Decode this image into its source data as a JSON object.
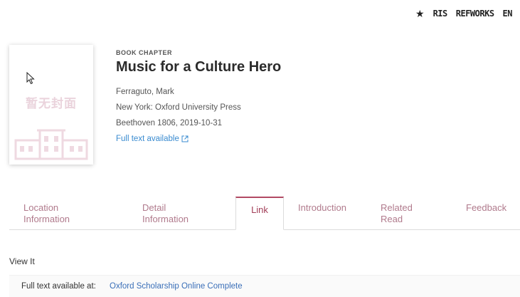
{
  "top_actions": {
    "items": [
      {
        "label": "RIS"
      },
      {
        "label": "REFWORKS"
      },
      {
        "label": "EN"
      }
    ]
  },
  "cover": {
    "placeholder_text": "暂无封面"
  },
  "record": {
    "type": "BOOK CHAPTER",
    "title": "Music for a Culture Hero",
    "author": "Ferraguto, Mark",
    "publisher": "New York: Oxford University Press",
    "source": "Beethoven 1806, 2019-10-31",
    "fulltext_label": "Full text available"
  },
  "tabs": [
    {
      "line1": "Location",
      "line2": "Information",
      "active": false
    },
    {
      "line1": "Detail",
      "line2": "Information",
      "active": false
    },
    {
      "line1": "Link",
      "line2": "",
      "active": true
    },
    {
      "line1": "Introduction",
      "line2": "",
      "active": false
    },
    {
      "line1": "Related",
      "line2": "Read",
      "active": false
    },
    {
      "line1": "Feedback",
      "line2": "",
      "active": false
    }
  ],
  "view_it": {
    "heading": "View It",
    "available_label": "Full text available at:",
    "available_source": "Oxford Scholarship Online Complete"
  },
  "colors": {
    "accent": "#b24a64",
    "tab_text": "#b07a8c",
    "link": "#3a8bd0",
    "cover_placeholder": "#ead3dc"
  }
}
